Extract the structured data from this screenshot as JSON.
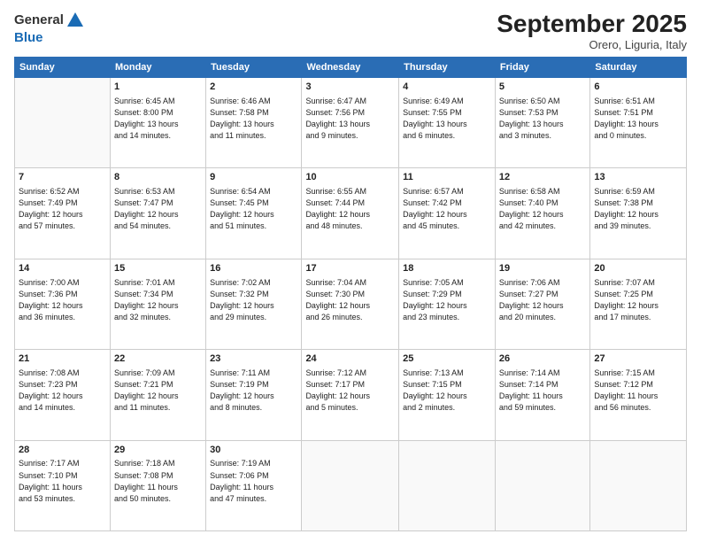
{
  "logo": {
    "line1": "General",
    "line2": "Blue"
  },
  "title": "September 2025",
  "location": "Orero, Liguria, Italy",
  "weekdays": [
    "Sunday",
    "Monday",
    "Tuesday",
    "Wednesday",
    "Thursday",
    "Friday",
    "Saturday"
  ],
  "weeks": [
    [
      {
        "day": "",
        "info": ""
      },
      {
        "day": "1",
        "info": "Sunrise: 6:45 AM\nSunset: 8:00 PM\nDaylight: 13 hours\nand 14 minutes."
      },
      {
        "day": "2",
        "info": "Sunrise: 6:46 AM\nSunset: 7:58 PM\nDaylight: 13 hours\nand 11 minutes."
      },
      {
        "day": "3",
        "info": "Sunrise: 6:47 AM\nSunset: 7:56 PM\nDaylight: 13 hours\nand 9 minutes."
      },
      {
        "day": "4",
        "info": "Sunrise: 6:49 AM\nSunset: 7:55 PM\nDaylight: 13 hours\nand 6 minutes."
      },
      {
        "day": "5",
        "info": "Sunrise: 6:50 AM\nSunset: 7:53 PM\nDaylight: 13 hours\nand 3 minutes."
      },
      {
        "day": "6",
        "info": "Sunrise: 6:51 AM\nSunset: 7:51 PM\nDaylight: 13 hours\nand 0 minutes."
      }
    ],
    [
      {
        "day": "7",
        "info": "Sunrise: 6:52 AM\nSunset: 7:49 PM\nDaylight: 12 hours\nand 57 minutes."
      },
      {
        "day": "8",
        "info": "Sunrise: 6:53 AM\nSunset: 7:47 PM\nDaylight: 12 hours\nand 54 minutes."
      },
      {
        "day": "9",
        "info": "Sunrise: 6:54 AM\nSunset: 7:45 PM\nDaylight: 12 hours\nand 51 minutes."
      },
      {
        "day": "10",
        "info": "Sunrise: 6:55 AM\nSunset: 7:44 PM\nDaylight: 12 hours\nand 48 minutes."
      },
      {
        "day": "11",
        "info": "Sunrise: 6:57 AM\nSunset: 7:42 PM\nDaylight: 12 hours\nand 45 minutes."
      },
      {
        "day": "12",
        "info": "Sunrise: 6:58 AM\nSunset: 7:40 PM\nDaylight: 12 hours\nand 42 minutes."
      },
      {
        "day": "13",
        "info": "Sunrise: 6:59 AM\nSunset: 7:38 PM\nDaylight: 12 hours\nand 39 minutes."
      }
    ],
    [
      {
        "day": "14",
        "info": "Sunrise: 7:00 AM\nSunset: 7:36 PM\nDaylight: 12 hours\nand 36 minutes."
      },
      {
        "day": "15",
        "info": "Sunrise: 7:01 AM\nSunset: 7:34 PM\nDaylight: 12 hours\nand 32 minutes."
      },
      {
        "day": "16",
        "info": "Sunrise: 7:02 AM\nSunset: 7:32 PM\nDaylight: 12 hours\nand 29 minutes."
      },
      {
        "day": "17",
        "info": "Sunrise: 7:04 AM\nSunset: 7:30 PM\nDaylight: 12 hours\nand 26 minutes."
      },
      {
        "day": "18",
        "info": "Sunrise: 7:05 AM\nSunset: 7:29 PM\nDaylight: 12 hours\nand 23 minutes."
      },
      {
        "day": "19",
        "info": "Sunrise: 7:06 AM\nSunset: 7:27 PM\nDaylight: 12 hours\nand 20 minutes."
      },
      {
        "day": "20",
        "info": "Sunrise: 7:07 AM\nSunset: 7:25 PM\nDaylight: 12 hours\nand 17 minutes."
      }
    ],
    [
      {
        "day": "21",
        "info": "Sunrise: 7:08 AM\nSunset: 7:23 PM\nDaylight: 12 hours\nand 14 minutes."
      },
      {
        "day": "22",
        "info": "Sunrise: 7:09 AM\nSunset: 7:21 PM\nDaylight: 12 hours\nand 11 minutes."
      },
      {
        "day": "23",
        "info": "Sunrise: 7:11 AM\nSunset: 7:19 PM\nDaylight: 12 hours\nand 8 minutes."
      },
      {
        "day": "24",
        "info": "Sunrise: 7:12 AM\nSunset: 7:17 PM\nDaylight: 12 hours\nand 5 minutes."
      },
      {
        "day": "25",
        "info": "Sunrise: 7:13 AM\nSunset: 7:15 PM\nDaylight: 12 hours\nand 2 minutes."
      },
      {
        "day": "26",
        "info": "Sunrise: 7:14 AM\nSunset: 7:14 PM\nDaylight: 11 hours\nand 59 minutes."
      },
      {
        "day": "27",
        "info": "Sunrise: 7:15 AM\nSunset: 7:12 PM\nDaylight: 11 hours\nand 56 minutes."
      }
    ],
    [
      {
        "day": "28",
        "info": "Sunrise: 7:17 AM\nSunset: 7:10 PM\nDaylight: 11 hours\nand 53 minutes."
      },
      {
        "day": "29",
        "info": "Sunrise: 7:18 AM\nSunset: 7:08 PM\nDaylight: 11 hours\nand 50 minutes."
      },
      {
        "day": "30",
        "info": "Sunrise: 7:19 AM\nSunset: 7:06 PM\nDaylight: 11 hours\nand 47 minutes."
      },
      {
        "day": "",
        "info": ""
      },
      {
        "day": "",
        "info": ""
      },
      {
        "day": "",
        "info": ""
      },
      {
        "day": "",
        "info": ""
      }
    ]
  ]
}
